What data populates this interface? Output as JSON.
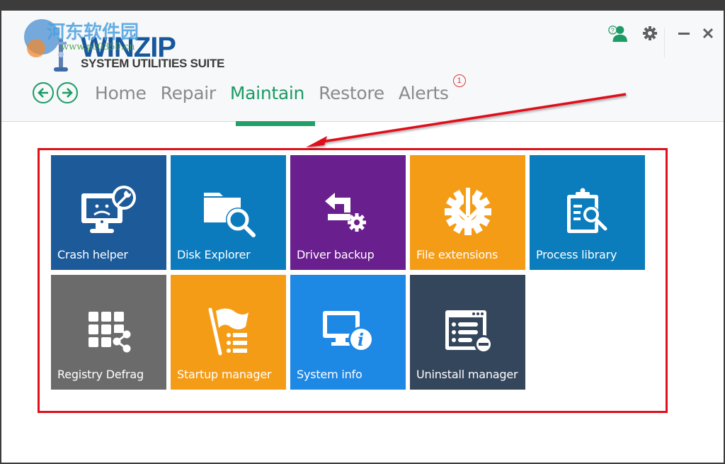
{
  "app": {
    "brand": "WINZIP",
    "subtitle": "SYSTEM UTILITIES SUITE",
    "watermark_text": "河东软件园",
    "watermark_url": "www.pc0359.cn"
  },
  "window_controls": {
    "support_icon": "support-user-icon",
    "settings_icon": "gear-icon",
    "minimize_label": "–",
    "close_label": "✕"
  },
  "nav": {
    "back_icon": "arrow-left-icon",
    "forward_icon": "arrow-right-icon",
    "tabs": [
      {
        "label": "Home",
        "active": false
      },
      {
        "label": "Repair",
        "active": false
      },
      {
        "label": "Maintain",
        "active": true
      },
      {
        "label": "Restore",
        "active": false
      },
      {
        "label": "Alerts",
        "active": false,
        "badge": "1"
      }
    ]
  },
  "tiles": [
    {
      "label": "Crash helper",
      "icon": "crash-monitor-wrench-icon",
      "color": "#1c5a9a"
    },
    {
      "label": "Disk Explorer",
      "icon": "folder-search-icon",
      "color": "#0c7bbd"
    },
    {
      "label": "Driver backup",
      "icon": "driver-backup-icon",
      "color": "#6a1f8e"
    },
    {
      "label": "File extensions",
      "icon": "gear-download-icon",
      "color": "#f59c17"
    },
    {
      "label": "Process library",
      "icon": "clipboard-search-icon",
      "color": "#0b7cbc"
    },
    {
      "label": "Registry Defrag",
      "icon": "grid-share-icon",
      "color": "#6b6b6b"
    },
    {
      "label": "Startup manager",
      "icon": "flag-list-icon",
      "color": "#f59c17"
    },
    {
      "label": "System info",
      "icon": "monitor-info-icon",
      "color": "#1e88e5"
    },
    {
      "label": "Uninstall manager",
      "icon": "window-list-minus-icon",
      "color": "#34465c"
    }
  ],
  "annotation": {
    "color": "#e0101a"
  }
}
